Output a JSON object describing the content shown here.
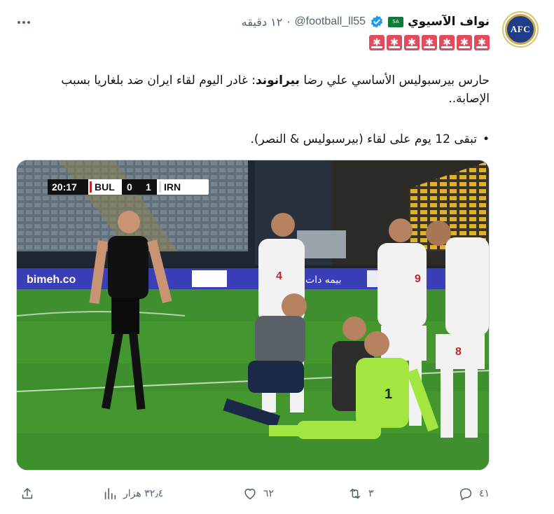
{
  "header": {
    "display_name": "نواف الآسيوي",
    "handle": "@football_ll55",
    "separator": "·",
    "time": "١٢ دقيقه",
    "avatar_text": "AFC",
    "flag_text": "SA"
  },
  "post": {
    "line1_pre": "حارس بيرسبوليس الأساسي علي رضا ",
    "line1_bold": "بيرانوند",
    "line1_post": ": غادر اليوم لقاء ايران ضد بلغاريا بسبب الإصابة..",
    "bullet": "•",
    "line2": "تبقى 12 يوم على لقاء (بيرسبوليس & النصر)."
  },
  "media": {
    "scoreboard": {
      "time": "20:17",
      "home": "BUL",
      "home_score": "0",
      "away_score": "1",
      "away": "IRN"
    },
    "ad_left": "bimeh.co",
    "ad_right": "بيمه دات كام",
    "shirt_numbers": [
      "4",
      "9",
      "8",
      "1"
    ]
  },
  "actions": {
    "replies": "٤١",
    "reposts": "٣",
    "likes": "٦٢",
    "views": "٣٢٫٤ هزار"
  },
  "colors": {
    "pitch": "#3f8f2e",
    "keeper_kit": "#a4e640",
    "iran_kit": "#f2f2f2",
    "verified": "#1d9bf0",
    "muted": "#536471"
  }
}
